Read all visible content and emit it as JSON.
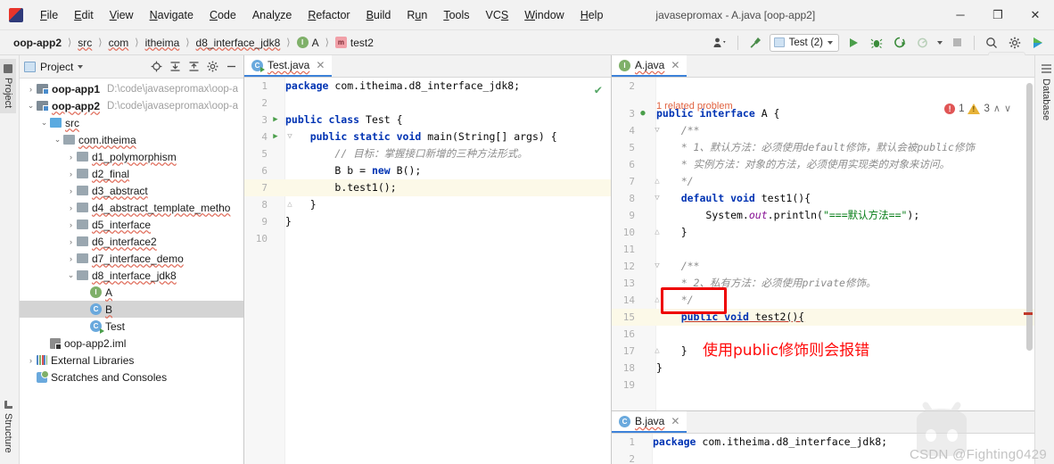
{
  "window": {
    "title": "javasepromax - A.java [oop-app2]",
    "app_icon": "intellij-idea-icon",
    "minimize": "─",
    "maximize": "❐",
    "close": "✕"
  },
  "menubar": [
    {
      "label": "File",
      "mnemonic": "F"
    },
    {
      "label": "Edit",
      "mnemonic": "E"
    },
    {
      "label": "View",
      "mnemonic": "V"
    },
    {
      "label": "Navigate",
      "mnemonic": "N"
    },
    {
      "label": "Code",
      "mnemonic": "C"
    },
    {
      "label": "Analyze",
      "mnemonic": "y"
    },
    {
      "label": "Refactor",
      "mnemonic": "R"
    },
    {
      "label": "Build",
      "mnemonic": "B"
    },
    {
      "label": "Run",
      "mnemonic": "u"
    },
    {
      "label": "Tools",
      "mnemonic": "T"
    },
    {
      "label": "VCS",
      "mnemonic": "S"
    },
    {
      "label": "Window",
      "mnemonic": "W"
    },
    {
      "label": "Help",
      "mnemonic": "H"
    }
  ],
  "breadcrumb": [
    {
      "label": "oop-app2",
      "icon": null,
      "bold": true
    },
    {
      "label": "src",
      "icon": null,
      "bold": false
    },
    {
      "label": "com",
      "icon": null,
      "bold": false
    },
    {
      "label": "itheima",
      "icon": null,
      "bold": false
    },
    {
      "label": "d8_interface_jdk8",
      "icon": null,
      "bold": false
    },
    {
      "label": "A",
      "icon": "interface-badge",
      "bold": false
    },
    {
      "label": "test2",
      "icon": "method-badge",
      "bold": false
    }
  ],
  "toolbar": {
    "user_icon": "user-dropdown-icon",
    "build_icon": "hammer-build-icon",
    "run_config": "Test (2)",
    "run_icon": "run-play-icon",
    "debug_icon": "debug-bug-icon",
    "run_coverage_icon": "run-with-coverage-icon",
    "profile_icon": "profiler-icon",
    "stop_icon": "stop-icon",
    "search_icon": "search-everywhere-icon",
    "settings_icon": "settings-gear-icon",
    "updates_icon": "ide-updates-icon",
    "help_ghost": "?"
  },
  "rails": {
    "left_top": "Project",
    "left_bottom": "Structure",
    "right_top": "Database"
  },
  "project_panel": {
    "title": "Project",
    "icons": [
      "locate-icon",
      "expand-all-icon",
      "collapse-all-icon",
      "settings-gear-icon",
      "hide-icon"
    ],
    "tree": [
      {
        "depth": 0,
        "arrow": "collapsed",
        "icon": "module-folder",
        "label": "oop-app1",
        "bold": true,
        "squiggle": false,
        "path": "D:\\code\\javasepromax\\oop-a",
        "selected": false
      },
      {
        "depth": 0,
        "arrow": "expanded",
        "icon": "module-folder",
        "label": "oop-app2",
        "bold": true,
        "squiggle": true,
        "path": "D:\\code\\javasepromax\\oop-a",
        "selected": false
      },
      {
        "depth": 1,
        "arrow": "expanded",
        "icon": "source-folder",
        "label": "src",
        "bold": false,
        "squiggle": true,
        "path": "",
        "selected": false
      },
      {
        "depth": 2,
        "arrow": "expanded",
        "icon": "package-folder",
        "label": "com.itheima",
        "bold": false,
        "squiggle": true,
        "path": "",
        "selected": false
      },
      {
        "depth": 3,
        "arrow": "collapsed",
        "icon": "package-folder",
        "label": "d1_polymorphism",
        "bold": false,
        "squiggle": true,
        "path": "",
        "selected": false
      },
      {
        "depth": 3,
        "arrow": "collapsed",
        "icon": "package-folder",
        "label": "d2_final",
        "bold": false,
        "squiggle": true,
        "path": "",
        "selected": false
      },
      {
        "depth": 3,
        "arrow": "collapsed",
        "icon": "package-folder",
        "label": "d3_abstract",
        "bold": false,
        "squiggle": true,
        "path": "",
        "selected": false
      },
      {
        "depth": 3,
        "arrow": "collapsed",
        "icon": "package-folder",
        "label": "d4_abstract_template_metho",
        "bold": false,
        "squiggle": true,
        "path": "",
        "selected": false
      },
      {
        "depth": 3,
        "arrow": "collapsed",
        "icon": "package-folder",
        "label": "d5_interface",
        "bold": false,
        "squiggle": true,
        "path": "",
        "selected": false
      },
      {
        "depth": 3,
        "arrow": "collapsed",
        "icon": "package-folder",
        "label": "d6_interface2",
        "bold": false,
        "squiggle": true,
        "path": "",
        "selected": false
      },
      {
        "depth": 3,
        "arrow": "collapsed",
        "icon": "package-folder",
        "label": "d7_interface_demo",
        "bold": false,
        "squiggle": true,
        "path": "",
        "selected": false
      },
      {
        "depth": 3,
        "arrow": "expanded",
        "icon": "package-folder",
        "label": "d8_interface_jdk8",
        "bold": false,
        "squiggle": true,
        "path": "",
        "selected": false
      },
      {
        "depth": 4,
        "arrow": "none",
        "icon": "interface-badge",
        "label": "A",
        "bold": false,
        "squiggle": true,
        "path": "",
        "selected": false
      },
      {
        "depth": 4,
        "arrow": "none",
        "icon": "class-badge",
        "label": "B",
        "bold": false,
        "squiggle": true,
        "path": "",
        "selected": true
      },
      {
        "depth": 4,
        "arrow": "none",
        "icon": "runnable-class-badge",
        "label": "Test",
        "bold": false,
        "squiggle": false,
        "path": "",
        "selected": false
      },
      {
        "depth": 1,
        "arrow": "none",
        "icon": "iml-file",
        "label": "oop-app2.iml",
        "bold": false,
        "squiggle": false,
        "path": "",
        "selected": false
      },
      {
        "depth": 0,
        "arrow": "collapsed",
        "icon": "libraries",
        "label": "External Libraries",
        "bold": false,
        "squiggle": false,
        "path": "",
        "selected": false
      },
      {
        "depth": 0,
        "arrow": "none",
        "icon": "scratches",
        "label": "Scratches and Consoles",
        "bold": false,
        "squiggle": false,
        "path": "",
        "selected": false
      }
    ]
  },
  "editor_left": {
    "tab": {
      "label": "Test.java",
      "icon": "runnable-class-badge",
      "close": "✕"
    },
    "status_icon": "inspection-ok-check",
    "lines": [
      {
        "n": "1",
        "run": false,
        "fold": "",
        "caret": false,
        "tokens": [
          {
            "t": "package",
            "c": "kw"
          },
          {
            "t": " com.itheima.d8_interface_jdk8;",
            "c": "pl"
          }
        ],
        "indent": 0
      },
      {
        "n": "2",
        "run": false,
        "fold": "",
        "caret": false,
        "tokens": [],
        "indent": 0
      },
      {
        "n": "3",
        "run": true,
        "fold": "",
        "caret": false,
        "tokens": [
          {
            "t": "public class",
            "c": "kw"
          },
          {
            "t": " Test {",
            "c": "pl"
          }
        ],
        "indent": 0
      },
      {
        "n": "4",
        "run": true,
        "fold": "▽",
        "caret": false,
        "tokens": [
          {
            "t": "public static void",
            "c": "kw"
          },
          {
            "t": " ",
            "c": "pl"
          },
          {
            "t": "main",
            "c": "mth"
          },
          {
            "t": "(String[] args) {",
            "c": "pl"
          }
        ],
        "indent": 1
      },
      {
        "n": "5",
        "run": false,
        "fold": "",
        "caret": false,
        "tokens": [
          {
            "t": "// 目标：掌握接口新增的三种方法形式。",
            "c": "cm"
          }
        ],
        "indent": 2
      },
      {
        "n": "6",
        "run": false,
        "fold": "",
        "caret": false,
        "tokens": [
          {
            "t": "B b = ",
            "c": "pl"
          },
          {
            "t": "new",
            "c": "kw"
          },
          {
            "t": " B();",
            "c": "pl"
          }
        ],
        "indent": 2
      },
      {
        "n": "7",
        "run": false,
        "fold": "",
        "caret": true,
        "tokens": [
          {
            "t": "b.test1();",
            "c": "pl"
          }
        ],
        "indent": 2
      },
      {
        "n": "8",
        "run": false,
        "fold": "△",
        "caret": false,
        "tokens": [
          {
            "t": "}",
            "c": "pl"
          }
        ],
        "indent": 1
      },
      {
        "n": "9",
        "run": false,
        "fold": "",
        "caret": false,
        "tokens": [
          {
            "t": "}",
            "c": "pl"
          }
        ],
        "indent": 0
      },
      {
        "n": "10",
        "run": false,
        "fold": "",
        "caret": false,
        "tokens": [],
        "indent": 0
      }
    ]
  },
  "editor_right_top": {
    "tab": {
      "label": "A.java",
      "icon": "interface-badge",
      "close": "✕"
    },
    "related_problem": "1 related problem",
    "inspections": {
      "error_count": "1",
      "warning_count": "3",
      "prev": "∧",
      "next": "∨"
    },
    "lines": [
      {
        "n": "2",
        "gut": "",
        "fold": "",
        "caret": false,
        "tokens": [],
        "indent": 0
      },
      {
        "n": "3",
        "gut": "●",
        "fold": "",
        "caret": false,
        "tokens": [
          {
            "t": "public interface",
            "c": "kw"
          },
          {
            "t": " A {",
            "c": "pl"
          }
        ],
        "indent": 0
      },
      {
        "n": "4",
        "gut": "",
        "fold": "▽",
        "caret": false,
        "tokens": [
          {
            "t": "/**",
            "c": "cm"
          }
        ],
        "indent": 1
      },
      {
        "n": "5",
        "gut": "",
        "fold": "",
        "caret": false,
        "tokens": [
          {
            "t": "* 1、默认方法：必须使用default修饰，默认会被public修饰",
            "c": "cm"
          }
        ],
        "indent": 1
      },
      {
        "n": "6",
        "gut": "",
        "fold": "",
        "caret": false,
        "tokens": [
          {
            "t": "* 实例方法：对象的方法，必须使用实现类的对象来访问。",
            "c": "cm"
          }
        ],
        "indent": 1
      },
      {
        "n": "7",
        "gut": "",
        "fold": "△",
        "caret": false,
        "tokens": [
          {
            "t": "*/",
            "c": "cm"
          }
        ],
        "indent": 1
      },
      {
        "n": "8",
        "gut": "",
        "fold": "▽",
        "caret": false,
        "tokens": [
          {
            "t": "default void",
            "c": "kw"
          },
          {
            "t": " test1(){",
            "c": "pl"
          }
        ],
        "indent": 1
      },
      {
        "n": "9",
        "gut": "",
        "fold": "",
        "caret": false,
        "tokens": [
          {
            "t": "System.",
            "c": "pl"
          },
          {
            "t": "out",
            "c": "fld"
          },
          {
            "t": ".println(",
            "c": "pl"
          },
          {
            "t": "\"===默认方法==\"",
            "c": "st"
          },
          {
            "t": ");",
            "c": "pl"
          }
        ],
        "indent": 2
      },
      {
        "n": "10",
        "gut": "",
        "fold": "△",
        "caret": false,
        "tokens": [
          {
            "t": "}",
            "c": "pl"
          }
        ],
        "indent": 1
      },
      {
        "n": "11",
        "gut": "",
        "fold": "",
        "caret": false,
        "tokens": [],
        "indent": 0
      },
      {
        "n": "12",
        "gut": "",
        "fold": "▽",
        "caret": false,
        "tokens": [
          {
            "t": "/**",
            "c": "cm"
          }
        ],
        "indent": 1
      },
      {
        "n": "13",
        "gut": "",
        "fold": "",
        "caret": false,
        "tokens": [
          {
            "t": "* 2、私有方法：必须使用private修饰。",
            "c": "cm"
          }
        ],
        "indent": 1
      },
      {
        "n": "14",
        "gut": "",
        "fold": "△",
        "caret": false,
        "tokens": [
          {
            "t": "*/",
            "c": "cm"
          }
        ],
        "indent": 1
      },
      {
        "n": "15",
        "gut": "",
        "fold": "",
        "caret": true,
        "tokens": [
          {
            "t": "public void",
            "c": "kw-err"
          },
          {
            "t": " test2(){",
            "c": "pl-err"
          }
        ],
        "indent": 1
      },
      {
        "n": "16",
        "gut": "",
        "fold": "",
        "caret": false,
        "tokens": [],
        "indent": 0
      },
      {
        "n": "17",
        "gut": "",
        "fold": "△",
        "caret": false,
        "tokens": [
          {
            "t": "}",
            "c": "pl"
          }
        ],
        "indent": 1
      },
      {
        "n": "18",
        "gut": "",
        "fold": "",
        "caret": false,
        "tokens": [
          {
            "t": "}",
            "c": "pl"
          }
        ],
        "indent": 0
      },
      {
        "n": "19",
        "gut": "",
        "fold": "",
        "caret": false,
        "tokens": [],
        "indent": 0
      }
    ],
    "annotation": {
      "box_label": "red-highlight-box-around-public-void-test2",
      "text": "使用public修饰则会报错"
    }
  },
  "editor_right_bottom": {
    "tab": {
      "label": "B.java",
      "icon": "class-badge",
      "close": "✕"
    },
    "lines": [
      {
        "n": "1",
        "tokens": [
          {
            "t": "package",
            "c": "kw"
          },
          {
            "t": " com.itheima.d8_interface_jdk8;",
            "c": "pl"
          }
        ]
      },
      {
        "n": "2",
        "tokens": []
      }
    ]
  },
  "watermark": {
    "text": "CSDN @Fighting0429"
  },
  "colors": {
    "accent_blue": "#3d82d9",
    "keyword": "#0033b3",
    "string": "#067d17",
    "comment": "#8c8c8c",
    "error_red": "#ee0000",
    "warning_yellow": "#e8b339",
    "selection_gray": "#d4d4d4",
    "caret_line": "#fcf9e8"
  }
}
